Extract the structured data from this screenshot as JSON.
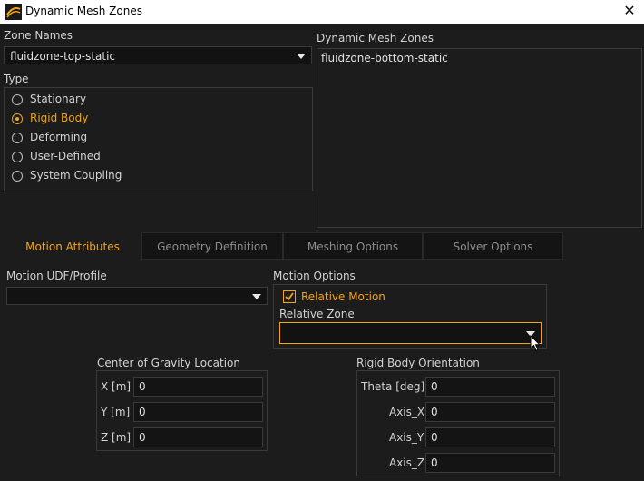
{
  "window": {
    "title": "Dynamic Mesh Zones",
    "close_glyph": "✕"
  },
  "zone_names": {
    "label": "Zone Names",
    "selected": "fluidzone-top-static"
  },
  "type": {
    "label": "Type",
    "options": [
      {
        "label": "Stationary",
        "checked": false
      },
      {
        "label": "Rigid Body",
        "checked": true
      },
      {
        "label": "Deforming",
        "checked": false
      },
      {
        "label": "User-Defined",
        "checked": false
      },
      {
        "label": "System Coupling",
        "checked": false
      }
    ]
  },
  "dynamic_mesh_zones": {
    "label": "Dynamic Mesh Zones",
    "items": [
      "fluidzone-bottom-static"
    ]
  },
  "tabs": [
    {
      "label": "Motion Attributes",
      "active": true
    },
    {
      "label": "Geometry Definition",
      "active": false
    },
    {
      "label": "Meshing Options",
      "active": false
    },
    {
      "label": "Solver Options",
      "active": false
    }
  ],
  "motion_udf": {
    "label": "Motion UDF/Profile",
    "value": ""
  },
  "motion_options": {
    "label": "Motion Options",
    "relative_motion": {
      "label": "Relative Motion",
      "checked": true
    },
    "relative_zone": {
      "label": "Relative Zone",
      "value": ""
    }
  },
  "cog": {
    "label": "Center of Gravity Location",
    "fields": [
      {
        "label": "X [m]",
        "value": "0"
      },
      {
        "label": "Y [m]",
        "value": "0"
      },
      {
        "label": "Z [m]",
        "value": "0"
      }
    ]
  },
  "orientation": {
    "label": "Rigid Body Orientation",
    "fields": [
      {
        "label": "Theta [deg]",
        "value": "0"
      },
      {
        "label": "Axis_X",
        "value": "0"
      },
      {
        "label": "Axis_Y",
        "value": "0"
      },
      {
        "label": "Axis_Z",
        "value": "0"
      }
    ]
  },
  "colors": {
    "accent": "#f2a516",
    "background": "#1c1c1c",
    "titlebar": "#ffffff"
  }
}
